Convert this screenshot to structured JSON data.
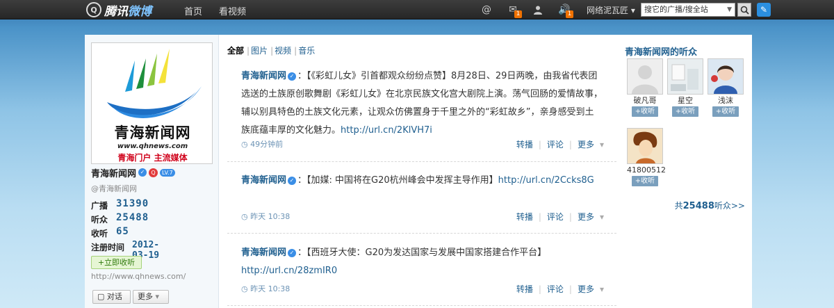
{
  "topbar": {
    "logo_mark": "Q",
    "logo_text_a": "腾讯",
    "logo_text_b": "微博",
    "nav": [
      "首页",
      "看视频"
    ],
    "mail_badge": "1",
    "sound_badge": "1",
    "user": "网络泥瓦匠",
    "search_placeholder": "搜它的广播/搜全站"
  },
  "profile": {
    "logo_name": "青海新闻网",
    "logo_url": "www.qhnews.com",
    "logo_slogan": "青海门户 主流媒体",
    "name": "青海新闻网",
    "level": "LV.7",
    "handle": "@青海新闻网",
    "stats": {
      "broadcast_label": "广播",
      "broadcast": "31390",
      "listeners_label": "听众",
      "listeners": "25488",
      "following_label": "收听",
      "following": "65",
      "reg_label": "注册时间",
      "reg": "2012-03-19"
    },
    "follow_btn": "+立即收听",
    "site": "http://www.qhnews.com/",
    "chat_btn": "对话",
    "more_btn": "更多"
  },
  "filter": {
    "active": "全部",
    "tabs": [
      "图片",
      "视频",
      "音乐"
    ]
  },
  "posts": [
    {
      "author": "青海新闻网",
      "text": "：【《彩虹儿女》引首都观众纷纷点赞】8月28日、29日两晚，由我省代表团选送的土族原创歌舞剧《彩虹儿女》在北京民族文化宫大剧院上演。荡气回肠的爱情故事，辅以别具特色的土族文化元素，让观众仿佛置身于千里之外的“彩虹故乡”，亲身感受到土族底蕴丰厚的文化魅力。",
      "link": "http://url.cn/2KlVH7i",
      "time": "49分钟前"
    },
    {
      "author": "青海新闻网",
      "text": "：【加媒: 中国将在G20杭州峰会中发挥主导作用】",
      "link": "http://url.cn/2Ccks8G",
      "time": "昨天 10:38"
    },
    {
      "author": "青海新闻网",
      "text": "：【西班牙大使：G20为发达国家与发展中国家搭建合作平台】",
      "link": "http://url.cn/28zmIR0",
      "time": "昨天 10:38"
    }
  ],
  "post_actions": {
    "repost": "转播",
    "comment": "评论",
    "more": "更多"
  },
  "listeners": {
    "title": "青海新闻网的听众",
    "fans": [
      {
        "name": "破凡哥",
        "btn": "+收听"
      },
      {
        "name": "星空",
        "btn": "+收听"
      },
      {
        "name": "浅沫",
        "btn": "+收听"
      },
      {
        "name": "41800512",
        "btn": "+收听"
      }
    ],
    "total_prefix": "共",
    "total": "25488",
    "total_suffix": "听众>>"
  },
  "colors": {
    "accent": "#1f5f8f",
    "topbar": "#2f2f2f",
    "badge": "#f07100"
  }
}
